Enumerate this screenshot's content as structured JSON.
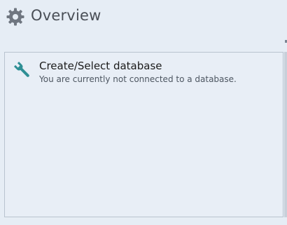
{
  "header": {
    "title": "Overview",
    "icon": "gear-icon"
  },
  "panel": {
    "items": [
      {
        "icon": "wrench-icon",
        "title": "Create/Select database",
        "subtitle": "You are currently not connected to a database."
      }
    ]
  },
  "colors": {
    "background": "#e6edf5",
    "panel_border": "#b9c3cf",
    "title_text": "#4a4f57",
    "wrench_teal": "#2f8f95",
    "gear_gray": "#6f7680"
  }
}
